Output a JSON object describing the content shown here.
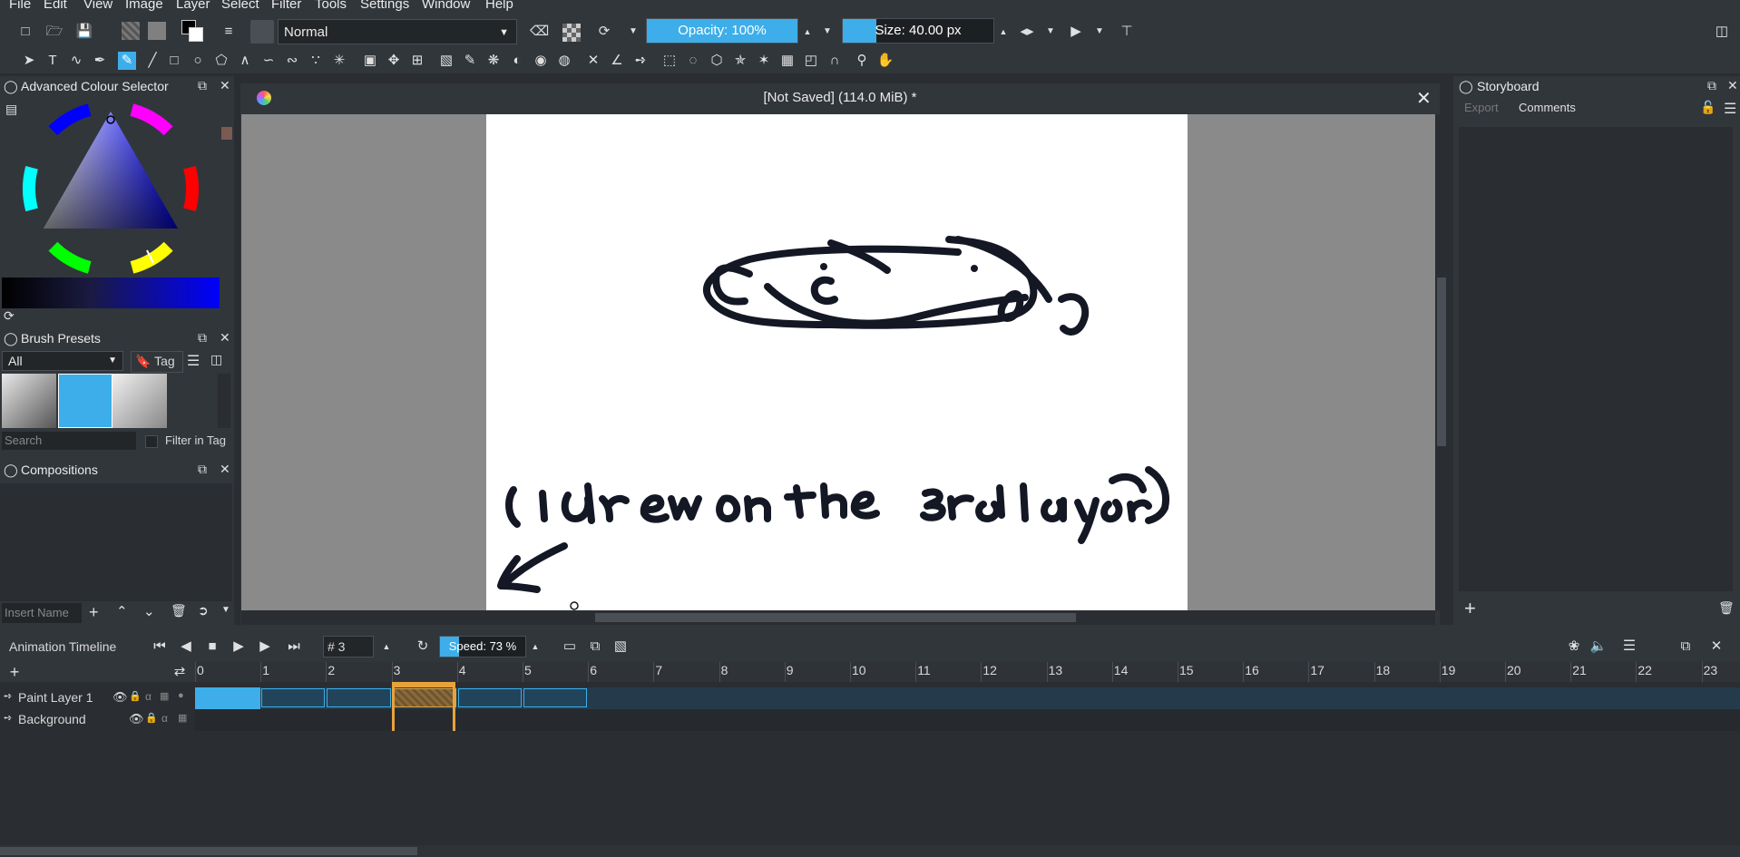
{
  "menu": [
    "File",
    "Edit",
    "View",
    "Image",
    "Layer",
    "Select",
    "Filter",
    "Tools",
    "Settings",
    "Window",
    "Help"
  ],
  "toolbar": {
    "blend_mode": "Normal",
    "opacity_label": "Opacity: 100%",
    "opacity_value": 1.0,
    "size_label": "Size: 40.00 px",
    "size_value": 0.22
  },
  "document": {
    "title": "[Not Saved]  (114.0 MiB) *"
  },
  "colour_selector": {
    "title": "Advanced Colour Selector",
    "hue_color": "#0000ff"
  },
  "brush_presets": {
    "title": "Brush Presets",
    "filter": "All",
    "tag_label": "Tag",
    "search_placeholder": "Search",
    "filter_in_tag": "Filter in Tag"
  },
  "compositions": {
    "title": "Compositions",
    "insert_placeholder": "Insert Name"
  },
  "storyboard": {
    "title": "Storyboard",
    "export_label": "Export",
    "comments_label": "Comments"
  },
  "timeline": {
    "title": "Animation Timeline",
    "frame_number": "# 3",
    "speed_label": "Speed: 73 %",
    "speed_value": 0.73,
    "frames": [
      "0",
      "1",
      "2",
      "3",
      "4",
      "5",
      "6",
      "7",
      "8",
      "9",
      "10",
      "11",
      "12",
      "13",
      "14",
      "15",
      "16",
      "17",
      "18",
      "19",
      "20",
      "21",
      "22",
      "23"
    ],
    "layers": [
      {
        "name": "Paint Layer 1"
      },
      {
        "name": "Background"
      }
    ]
  },
  "drawing_text": "(I drew on the 3rd layer)",
  "colors": {
    "accent": "#3daee9",
    "panel": "#31363b",
    "dark": "#2a2d31",
    "current_frame": "#e7a33b"
  }
}
